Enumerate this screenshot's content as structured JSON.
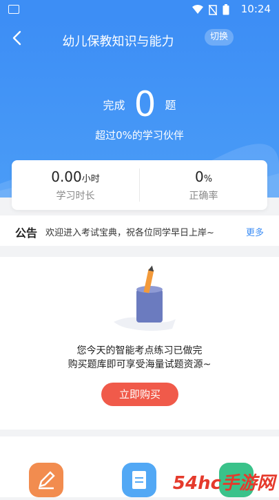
{
  "status_bar": {
    "time": "10:24"
  },
  "header": {
    "title": "幼儿保教知识与能力",
    "switch_label": "切换"
  },
  "progress": {
    "done_prefix": "完成",
    "done_count": "0",
    "done_suffix": "题",
    "exceed_text": "超过0%的学习伙伴"
  },
  "stats": [
    {
      "value": "0.00",
      "unit": "小时",
      "label": "学习时长"
    },
    {
      "value": "0",
      "unit": "%",
      "label": "正确率"
    }
  ],
  "notice": {
    "tag": "公告",
    "text": "欢迎进入考试宝典，祝各位同学早日上岸~",
    "more": "更多"
  },
  "practice": {
    "message_line1": "您今天的智能考点练习已做完",
    "message_line2": "购买题库即可享受海量试题资源~",
    "buy_label": "立即购买"
  },
  "bottom_icons": [
    "edit-icon",
    "test-icon",
    "exam-icon"
  ],
  "watermark": "54hc手游网",
  "colors": {
    "primary": "#3d8ef5",
    "buy": "#f05a4a"
  }
}
